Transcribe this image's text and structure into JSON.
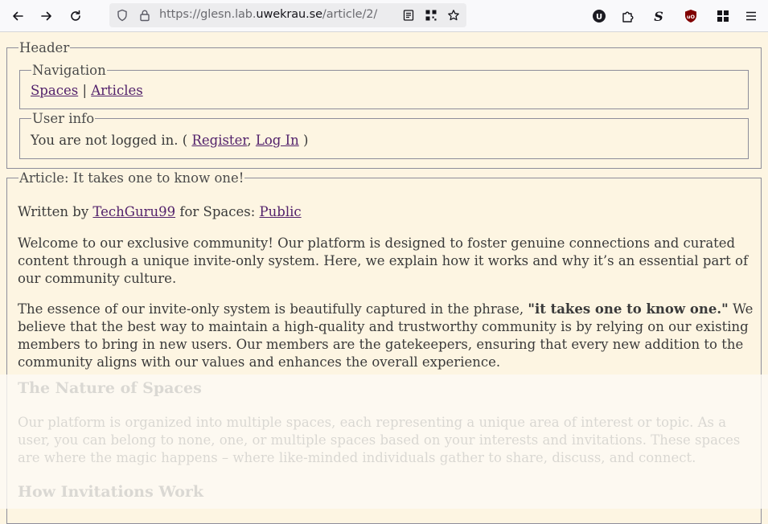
{
  "browser": {
    "url_prefix": "https://glesn.lab.",
    "url_domain": "uwekrau.se",
    "url_path": "/article/2/"
  },
  "header": {
    "legend": "Header",
    "navigation": {
      "legend": "Navigation",
      "spaces_link": "Spaces",
      "separator": "|",
      "articles_link": "Articles"
    },
    "user_info": {
      "legend": "User info",
      "text_before": "You are not logged in. (",
      "register_link": "Register",
      "comma": ",",
      "login_link": "Log In",
      "text_after": ")"
    }
  },
  "article": {
    "legend": "Article: It takes one to know one!",
    "written_by": "Written by",
    "author": "TechGuru99",
    "for_spaces": "for Spaces:",
    "space": "Public",
    "p1": "Welcome to our exclusive community! Our platform is designed to foster genuine connections and curated content through a unique invite-only system. Here, we explain how it works and why it’s an essential part of our community culture.",
    "p2_before": "The essence of our invite-only system is beautifully captured in the phrase,",
    "p2_bold": "\"it takes one to know one.\"",
    "p2_after": "We believe that the best way to maintain a high-quality and trustworthy community is by relying on our existing members to bring in new users. Our members are the gatekeepers, ensuring that every new addition to the community aligns with our values and enhances the overall experience.",
    "h2_1": "The Nature of Spaces",
    "p3": "Our platform is organized into multiple spaces, each representing a unique area of interest or topic. As a user, you can belong to none, one, or multiple spaces based on your interests and invitations. These spaces are where the magic happens – where like-minded individuals gather to share, discuss, and connect.",
    "h2_2": "How Invitations Work"
  }
}
